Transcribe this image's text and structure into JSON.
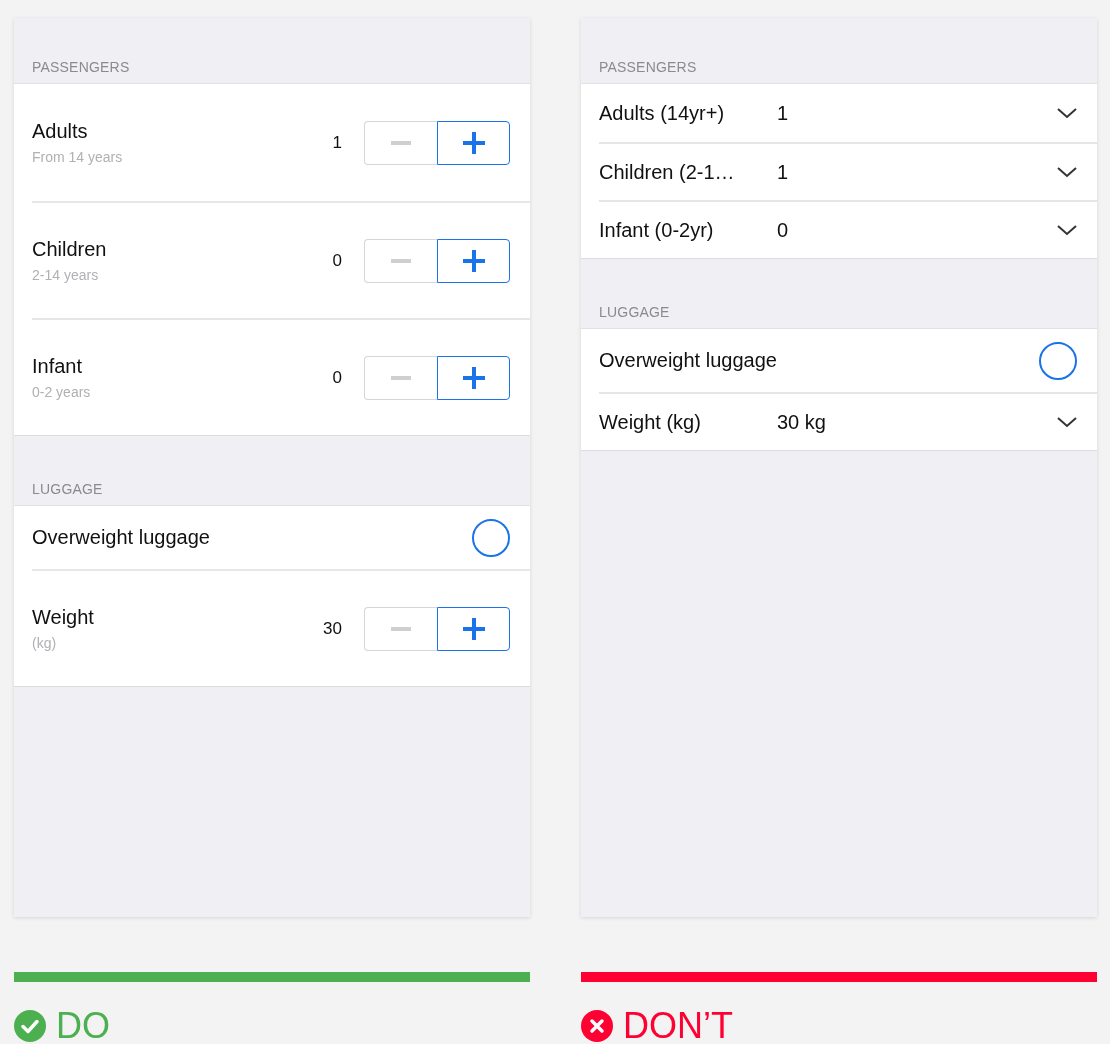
{
  "panels": [
    {
      "kind": "do",
      "color": "#4caf50",
      "verdict": "DO",
      "sections": [
        {
          "title": "PASSENGERS",
          "rows": [
            {
              "kind": "stepper",
              "label": "Adults",
              "hint": "From 14 years",
              "value": "1",
              "minus_disabled": true
            },
            {
              "kind": "stepper",
              "label": "Children",
              "hint": "2-14 years",
              "value": "0",
              "minus_disabled": true
            },
            {
              "kind": "stepper",
              "label": "Infant",
              "hint": "0-2 years",
              "value": "0",
              "minus_disabled": true
            }
          ]
        },
        {
          "title": "LUGGAGE",
          "rows": [
            {
              "kind": "toggle",
              "label": "Overweight luggage",
              "on": false
            },
            {
              "kind": "stepper",
              "label": "Weight",
              "hint": "(kg)",
              "value": "30",
              "minus_disabled": true
            }
          ]
        }
      ]
    },
    {
      "kind": "dont",
      "color": "#ff0033",
      "verdict": "DON’T",
      "sections": [
        {
          "title": "PASSENGERS",
          "rows": [
            {
              "kind": "picker",
              "label": "Adults (14yr+)",
              "value": "1"
            },
            {
              "kind": "picker",
              "label": "Children (2-1…",
              "value": "1"
            },
            {
              "kind": "picker",
              "label": "Infant (0-2yr)",
              "value": "0"
            }
          ]
        },
        {
          "title": "LUGGAGE",
          "rows": [
            {
              "kind": "toggle",
              "label": "Overweight luggage",
              "on": false
            },
            {
              "kind": "picker",
              "label": "Weight (kg)",
              "value": "30 kg"
            }
          ]
        }
      ]
    }
  ]
}
